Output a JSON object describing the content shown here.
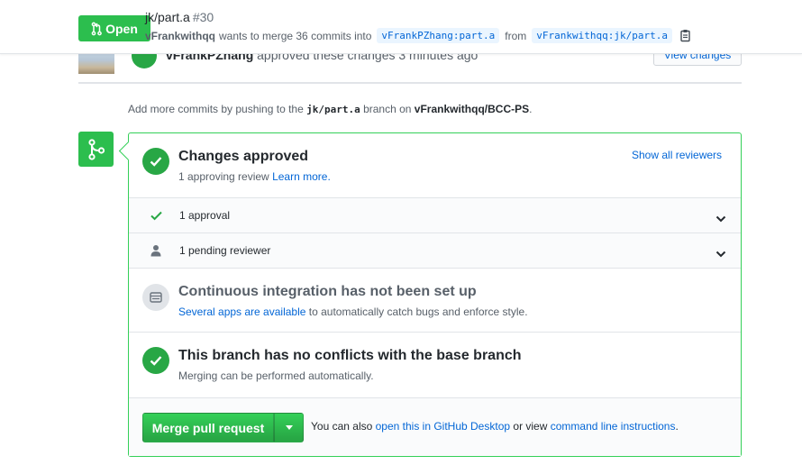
{
  "header": {
    "state": "Open",
    "title": "jk/part.a",
    "number": "#30",
    "author": "vFrankwithqq",
    "merge_text": "wants to merge 36 commits into",
    "base_ref": "vFrankPZhang:part.a",
    "from_text": "from",
    "head_ref": "vFrankwithqq:jk/part.a"
  },
  "review": {
    "author": "vFrankPZhang",
    "text": "approved these changes 3 minutes ago",
    "view_changes": "View changes"
  },
  "add_commits": {
    "prefix": "Add more commits by pushing to the",
    "branch": "jk/part.a",
    "middle": "branch on",
    "repo": "vFrankwithqq/BCC-PS",
    "suffix": "."
  },
  "merge_box": {
    "approved": {
      "title": "Changes approved",
      "desc": "1 approving review",
      "learn_more": "Learn more.",
      "show_reviewers": "Show all reviewers"
    },
    "approvals_row": "1 approval",
    "pending_row": "1 pending reviewer",
    "ci": {
      "title": "Continuous integration has not been set up",
      "link": "Several apps are available",
      "desc": "to automatically catch bugs and enforce style."
    },
    "conflicts": {
      "title": "This branch has no conflicts with the base branch",
      "desc": "Merging can be performed automatically."
    },
    "merge": {
      "button": "Merge pull request",
      "alt_prefix": "You can also",
      "desktop_link": "open this in GitHub Desktop",
      "alt_middle": "or view",
      "cli_link": "command line instructions",
      "alt_suffix": "."
    }
  },
  "colors": {
    "success": "#2cbe4e",
    "success_dark": "#28a745",
    "link": "#0366d6",
    "border_success": "#34d058"
  },
  "icons": {
    "state": "git-pull-request-icon",
    "merge": "git-merge-icon",
    "copy": "clippy-icon",
    "check": "check-icon",
    "person": "person-icon",
    "ci": "server-icon",
    "chevron": "chevron-down-icon"
  }
}
